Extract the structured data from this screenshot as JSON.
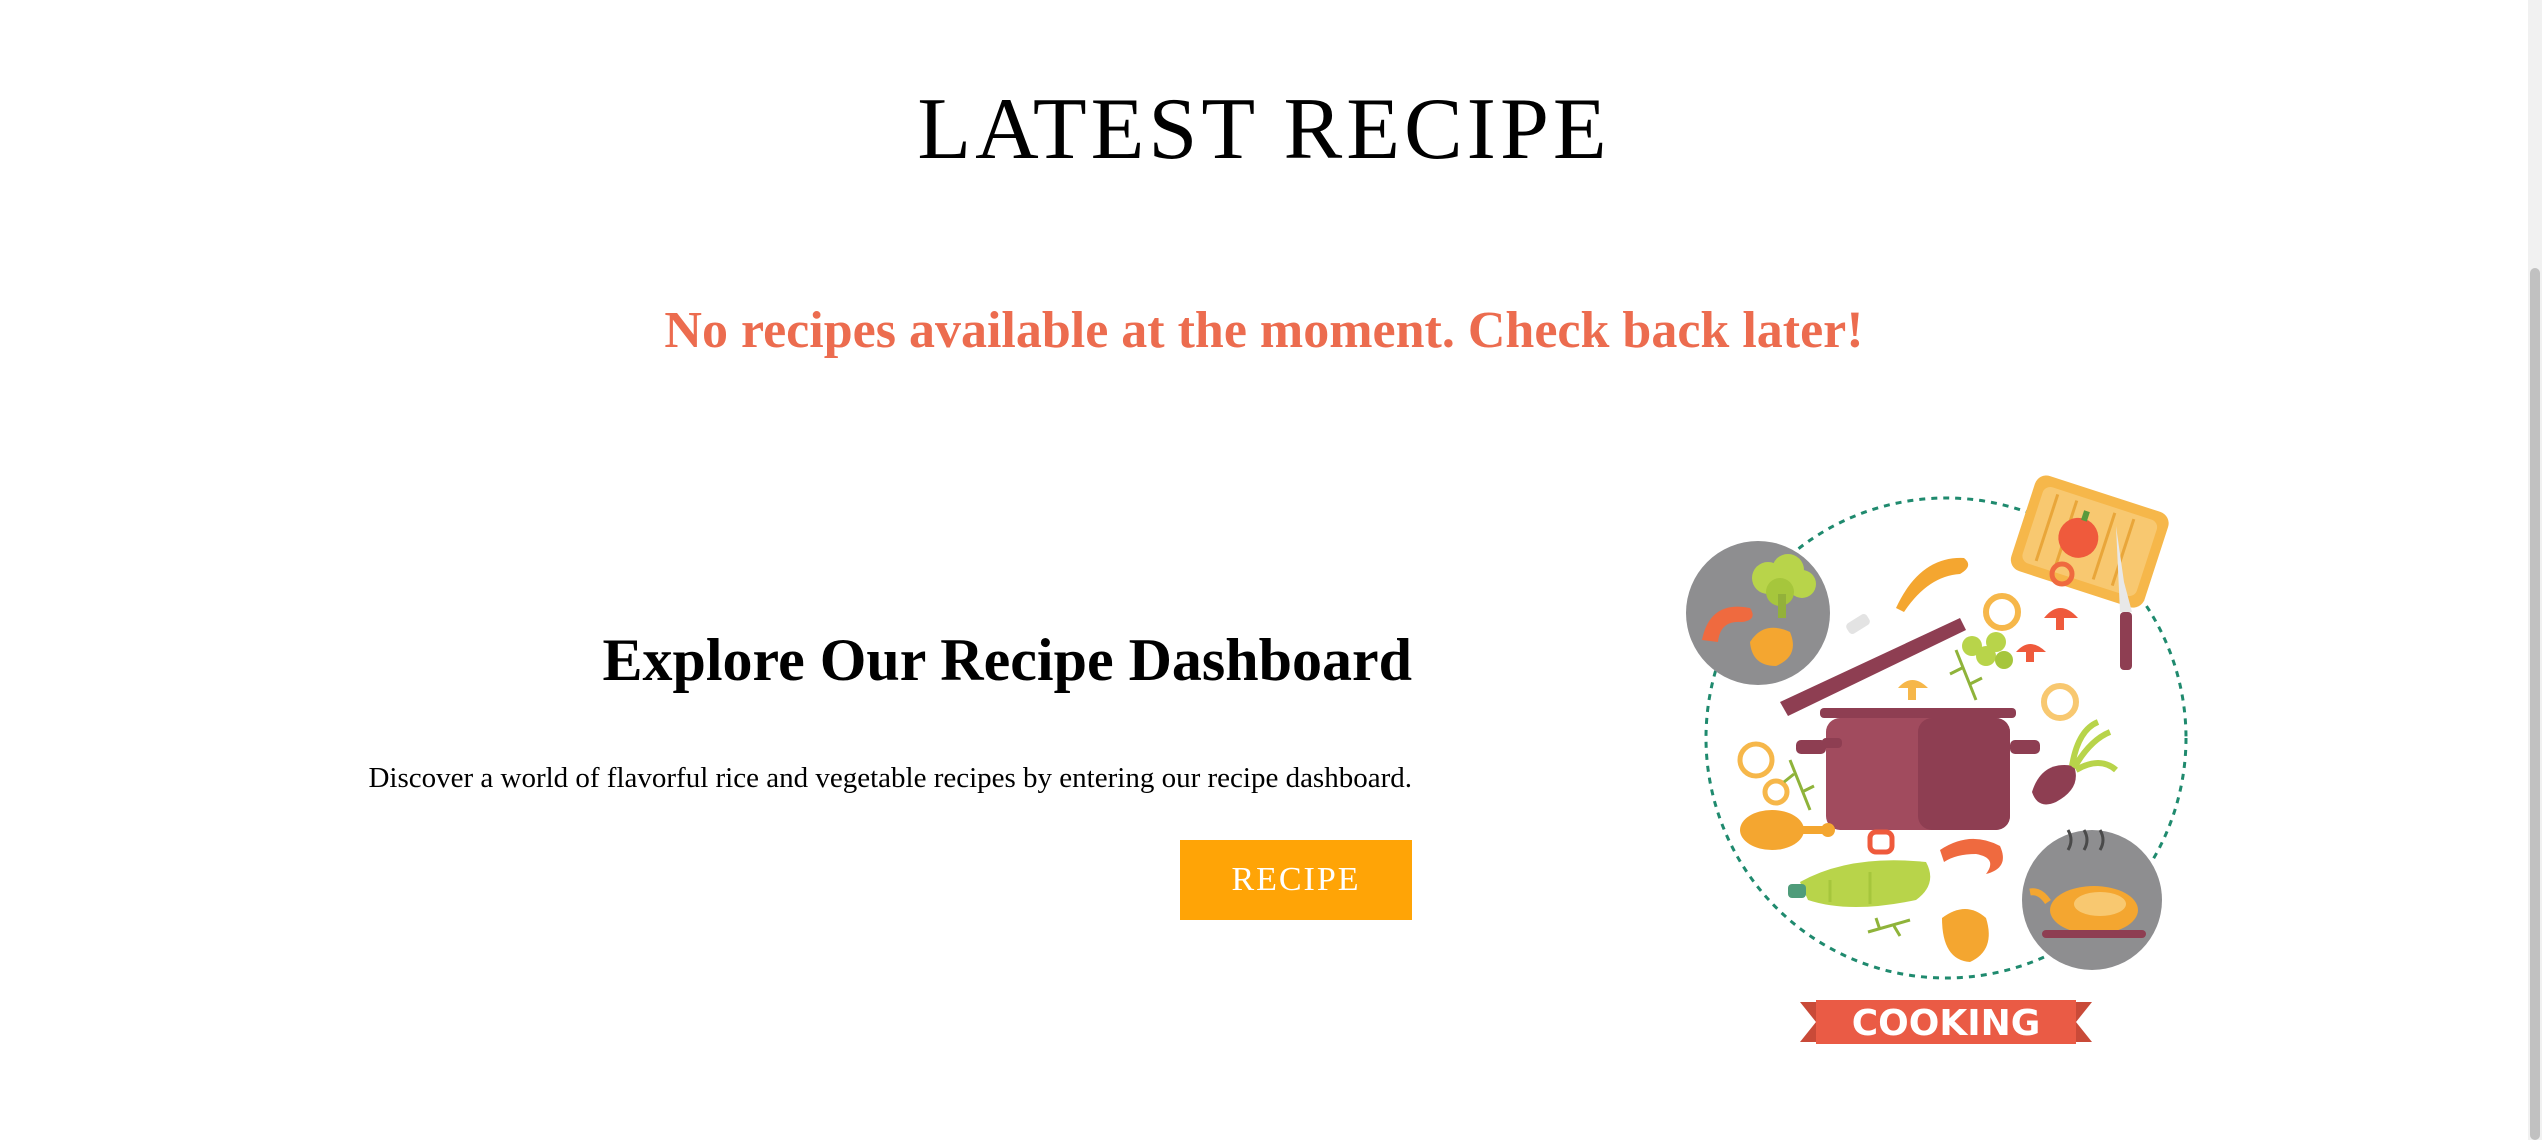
{
  "latest": {
    "title": "LATEST RECIPE",
    "empty_message": "No recipes available at the moment. Check back later!"
  },
  "explore": {
    "title": "Explore Our Recipe Dashboard",
    "description": "Discover a world of flavorful rice and vegetable recipes by entering our recipe dashboard.",
    "button_label": "RECIPE"
  },
  "illustration": {
    "banner_text": "COOKING"
  },
  "colors": {
    "message": "#ec6c4f",
    "button": "#ffa406",
    "banner": "#ea5b45",
    "pot": "#a14b5e",
    "dashed_ring": "#1f8a6e"
  }
}
